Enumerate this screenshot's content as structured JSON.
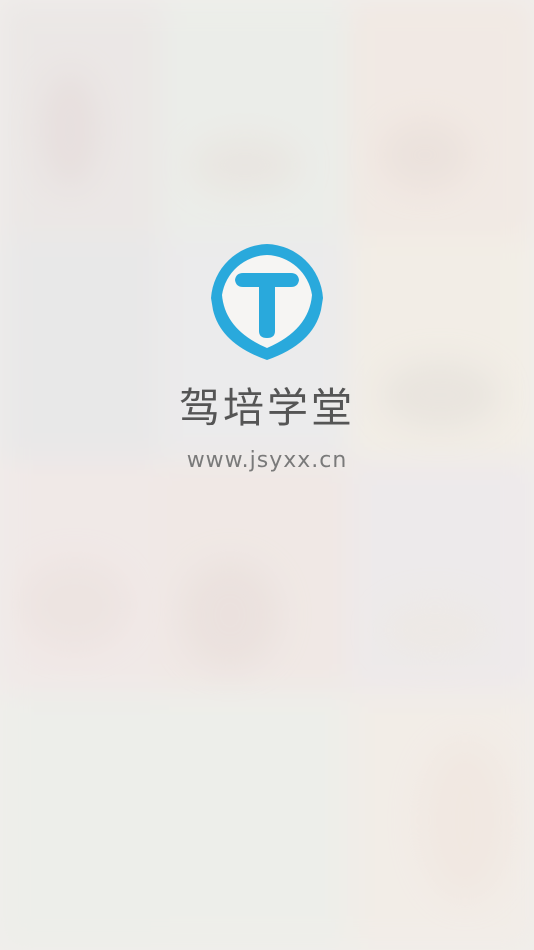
{
  "app": {
    "name": "驾培学堂",
    "url": "www.jsyxx.cn",
    "logo_icon": "t-shield-logo-icon",
    "brand_color": "#29a9dc"
  },
  "background": {
    "style": "blurred-photo-grid"
  }
}
